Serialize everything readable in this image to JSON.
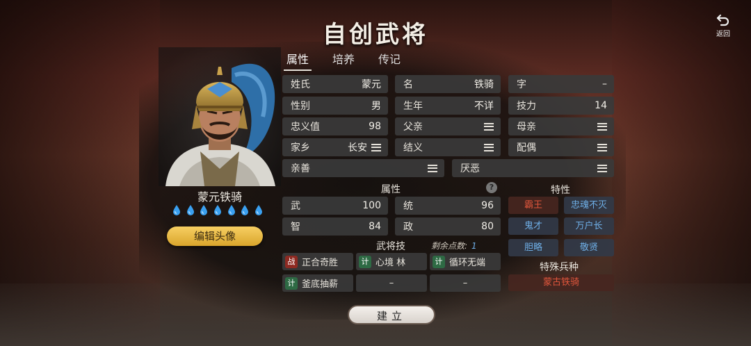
{
  "title": "自创武将",
  "back_label": "返回",
  "tabs": [
    "属性",
    "培养",
    "传记"
  ],
  "hero": {
    "name": "蒙元铁骑",
    "drop_count": 7,
    "edit_label": "编辑头像"
  },
  "info": {
    "surname": {
      "label": "姓氏",
      "value": "蒙元"
    },
    "given_name": {
      "label": "名",
      "value": "铁骑"
    },
    "courtesy": {
      "label": "字",
      "value": "–"
    },
    "gender": {
      "label": "性别",
      "value": "男"
    },
    "birth": {
      "label": "生年",
      "value": "不详"
    },
    "skill_power": {
      "label": "技力",
      "value": "14"
    },
    "loyalty": {
      "label": "忠义值",
      "value": "98"
    },
    "father": {
      "label": "父亲"
    },
    "mother": {
      "label": "母亲"
    },
    "hometown": {
      "label": "家乡",
      "value": "长安"
    },
    "sworn": {
      "label": "结义"
    },
    "spouse": {
      "label": "配偶"
    },
    "favor": {
      "label": "亲善"
    },
    "dislike": {
      "label": "厌恶"
    }
  },
  "attributes": {
    "header": "属性",
    "help": "?",
    "war": {
      "label": "武",
      "value": "100"
    },
    "lead": {
      "label": "统",
      "value": "96"
    },
    "intel": {
      "label": "智",
      "value": "84"
    },
    "politics": {
      "label": "政",
      "value": "80"
    }
  },
  "traits": {
    "header": "特性",
    "items": [
      {
        "label": "霸王",
        "color": "red"
      },
      {
        "label": "忠魂不灭",
        "color": "blue"
      },
      {
        "label": "鬼才",
        "color": "blue"
      },
      {
        "label": "万户长",
        "color": "blue"
      },
      {
        "label": "胆略",
        "color": "blue"
      },
      {
        "label": "敬贤",
        "color": "blue"
      }
    ]
  },
  "skills": {
    "header": "武将技",
    "remaining_label": "剩余点数:",
    "remaining_value": "1",
    "items": [
      {
        "tag": "战",
        "name": "正合奇胜",
        "tag_color": "red"
      },
      {
        "tag": "计",
        "name": "心境 林",
        "tag_color": "green"
      },
      {
        "tag": "计",
        "name": "循环无端",
        "tag_color": "green"
      },
      {
        "tag": "计",
        "name": "釜底抽薪",
        "tag_color": "green"
      },
      {
        "name": "–"
      },
      {
        "name": "–"
      }
    ]
  },
  "special_troop": {
    "header": "特殊兵种",
    "value": "蒙古铁骑"
  },
  "create_label": "建立",
  "colors": {
    "gold": "#f2c24e",
    "trait_red": "#e0563c",
    "trait_blue": "#6fb0e8",
    "skill_green": "#2e6a44",
    "skill_red": "#8e2a22"
  }
}
